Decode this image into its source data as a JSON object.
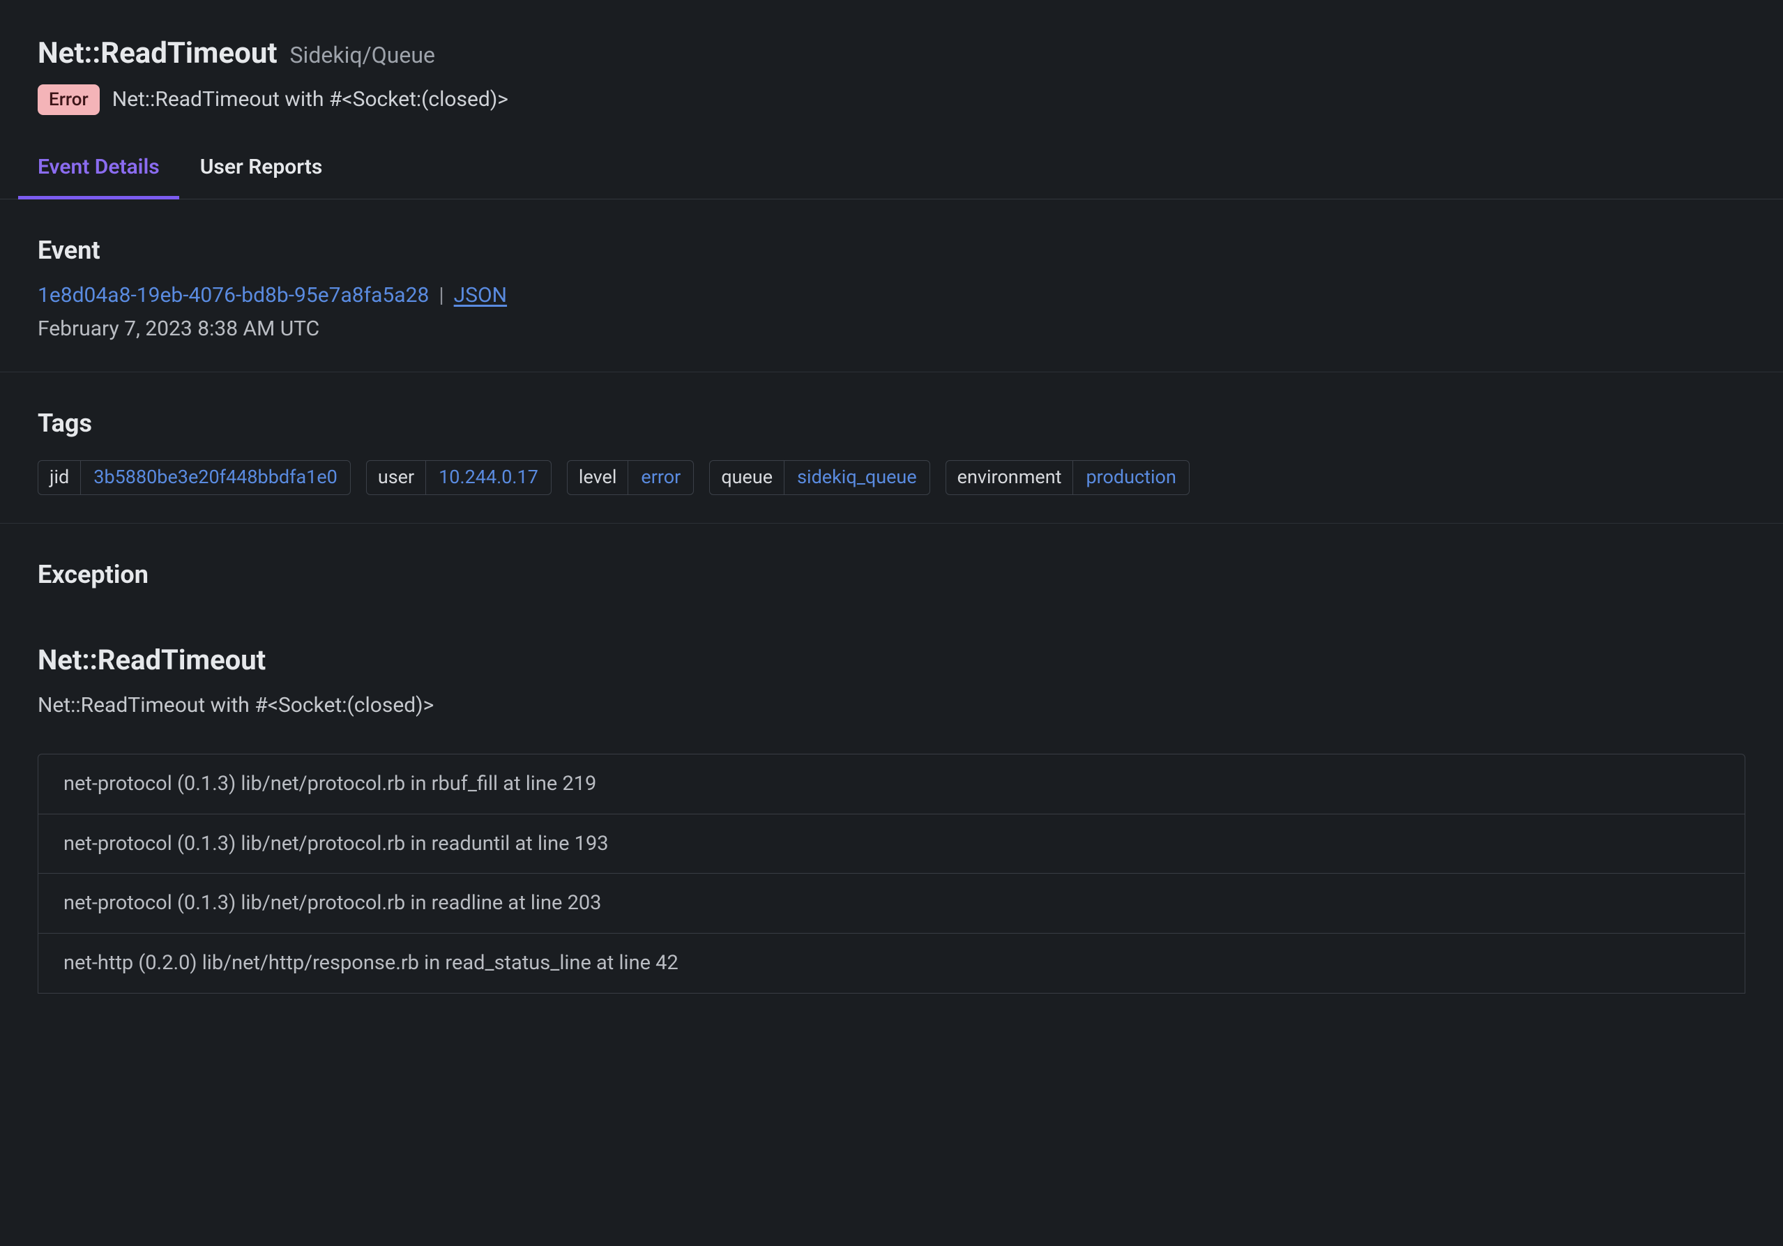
{
  "header": {
    "title": "Net::ReadTimeout",
    "context": "Sidekiq/Queue",
    "badge": "Error",
    "message": "Net::ReadTimeout with #<Socket:(closed)>"
  },
  "tabs": [
    {
      "label": "Event Details",
      "active": true
    },
    {
      "label": "User Reports",
      "active": false
    }
  ],
  "event": {
    "heading": "Event",
    "id": "1e8d04a8-19eb-4076-bd8b-95e7a8fa5a28",
    "json_label": "JSON",
    "timestamp": "February 7, 2023 8:38 AM UTC"
  },
  "tags": {
    "heading": "Tags",
    "items": [
      {
        "key": "jid",
        "value": "3b5880be3e20f448bbdfa1e0"
      },
      {
        "key": "user",
        "value": "10.244.0.17"
      },
      {
        "key": "level",
        "value": "error"
      },
      {
        "key": "queue",
        "value": "sidekiq_queue"
      },
      {
        "key": "environment",
        "value": "production"
      }
    ]
  },
  "exception": {
    "heading": "Exception",
    "type": "Net::ReadTimeout",
    "message": "Net::ReadTimeout with #<Socket:(closed)>",
    "frames": [
      "net-protocol (0.1.3) lib/net/protocol.rb in rbuf_fill at line 219",
      "net-protocol (0.1.3) lib/net/protocol.rb in readuntil at line 193",
      "net-protocol (0.1.3) lib/net/protocol.rb in readline at line 203",
      "net-http (0.2.0) lib/net/http/response.rb in read_status_line at line 42"
    ]
  }
}
